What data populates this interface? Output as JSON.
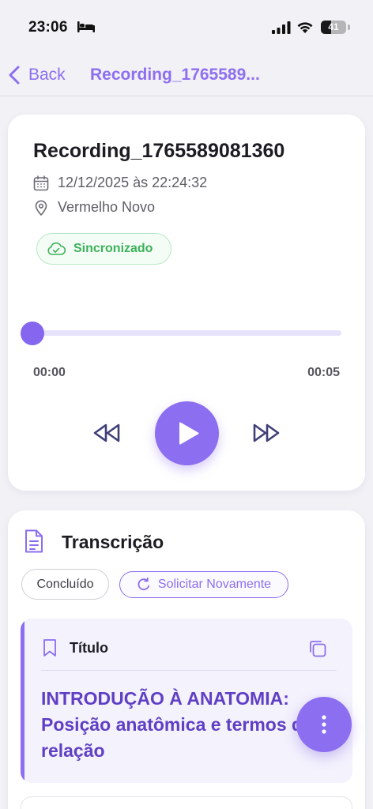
{
  "status_bar": {
    "time": "23:06",
    "battery_level": "41",
    "battery_fraction": 0.41
  },
  "nav": {
    "back_label": "Back",
    "title": "Recording_1765589..."
  },
  "recording": {
    "title": "Recording_1765589081360",
    "date": "12/12/2025 às 22:24:32",
    "location": "Vermelho Novo",
    "sync_status": "Sincronizado"
  },
  "player": {
    "current_time": "00:00",
    "total_time": "00:05",
    "progress": 0.0
  },
  "transcription": {
    "heading": "Transcrição",
    "status": "Concluído",
    "retry_label": "Solicitar Novamente",
    "title_label": "Título",
    "title_text": "INTRODUÇÃO À ANATOMIA: Posição anatômica e termos de relação"
  },
  "colors": {
    "accent": "#8c6ef0",
    "success": "#3cb25a",
    "title_text": "#5f3fc4"
  },
  "icons": {
    "back": "chevron-left-icon",
    "date": "calendar-icon",
    "location": "location-pin-icon",
    "sync": "cloud-check-icon",
    "rewind": "rewind-icon",
    "play": "play-icon",
    "forward": "fast-forward-icon",
    "document": "document-icon",
    "retry": "refresh-icon",
    "bookmark": "bookmark-icon",
    "copy": "copy-icon",
    "menu": "more-vertical-icon"
  }
}
